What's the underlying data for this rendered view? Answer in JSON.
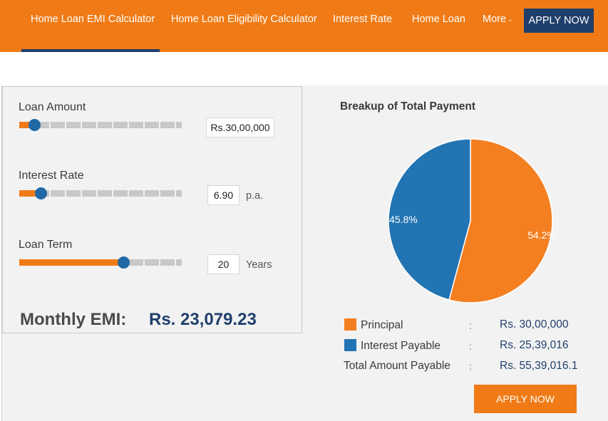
{
  "nav": {
    "items": [
      {
        "label": "Home Loan EMI Calculator"
      },
      {
        "label": "Home Loan Eligibility Calculator"
      },
      {
        "label": "Interest Rate"
      },
      {
        "label": "Home Loan"
      },
      {
        "label": "More"
      }
    ],
    "apply_label": "APPLY NOW"
  },
  "calculator": {
    "loan_amount": {
      "label": "Loan Amount",
      "value": "Rs.30,00,000",
      "slider_fraction": 0.09
    },
    "interest_rate": {
      "label": "Interest Rate",
      "value": "6.90",
      "unit": "p.a.",
      "slider_fraction": 0.13
    },
    "loan_term": {
      "label": "Loan Term",
      "value": "20",
      "unit": "Years",
      "slider_fraction": 0.64
    },
    "emi_label": "Monthly EMI:",
    "emi_value": "Rs. 23,079.23"
  },
  "breakup": {
    "title": "Breakup of Total Payment",
    "colors": {
      "principal": "#f47f20",
      "interest": "#2274b3"
    },
    "legend": [
      {
        "label": "Principal",
        "colon": ":",
        "value": "Rs. 30,00,000"
      },
      {
        "label": "Interest Payable",
        "colon": ":",
        "value": "Rs. 25,39,016"
      },
      {
        "label": "Total Amount Payable",
        "colon": ":",
        "value": "Rs. 55,39,016.1"
      }
    ],
    "apply_label": "APPLY NOW"
  },
  "chart_data": {
    "type": "pie",
    "categories": [
      "Principal",
      "Interest Payable"
    ],
    "values": [
      54.2,
      45.8
    ],
    "labels": [
      "54.2%",
      "45.8%"
    ],
    "title": "Breakup of Total Payment"
  }
}
